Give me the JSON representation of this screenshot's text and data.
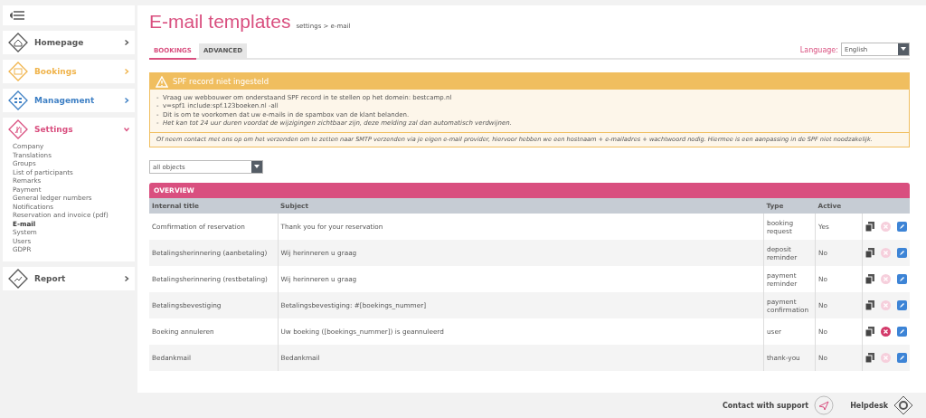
{
  "sidebar": {
    "menu_items": [
      {
        "label": "Homepage",
        "kind": "home",
        "expanded": false,
        "color": "#555555"
      },
      {
        "label": "Bookings",
        "kind": "calendar",
        "expanded": false,
        "color": "#f0b44c"
      },
      {
        "label": "Management",
        "kind": "grid",
        "expanded": false,
        "color": "#3d7fc4"
      },
      {
        "label": "Settings",
        "kind": "tools",
        "expanded": true,
        "color": "#d94f7f",
        "children": [
          {
            "label": "Company",
            "selected": false
          },
          {
            "label": "Translations",
            "selected": false
          },
          {
            "label": "Groups",
            "selected": false
          },
          {
            "label": "List of participants",
            "selected": false
          },
          {
            "label": "Remarks",
            "selected": false
          },
          {
            "label": "Payment",
            "selected": false
          },
          {
            "label": "General ledger numbers",
            "selected": false
          },
          {
            "label": "Notifications",
            "selected": false
          },
          {
            "label": "Reservation and invoice (pdf)",
            "selected": false
          },
          {
            "label": "E-mail",
            "selected": true
          },
          {
            "label": "System",
            "selected": false
          },
          {
            "label": "Users",
            "selected": false
          },
          {
            "label": "GDPR",
            "selected": false
          }
        ]
      },
      {
        "label": "Report",
        "kind": "chart",
        "expanded": false,
        "color": "#555555"
      }
    ]
  },
  "page": {
    "title": "E-mail templates",
    "breadcrumb": "settings > e-mail"
  },
  "tabs": [
    {
      "label": "BOOKINGS",
      "selected": true
    },
    {
      "label": "ADVANCED",
      "selected": false
    }
  ],
  "language": {
    "label": "Language:",
    "value": "English"
  },
  "alert": {
    "title": "SPF record niet ingesteld",
    "lines": [
      {
        "text": "-  Vraag uw webbouwer om onderstaand SPF record in te stellen op het domein: bestcamp.nl",
        "italic": false
      },
      {
        "text": "-  v=spf1 include:spf.123boeken.nl -all",
        "italic": false
      },
      {
        "text": "-  Dit is om te voorkomen dat uw e-mails in de spambox van de klant belanden.",
        "italic": false
      },
      {
        "text": "-  Het kan tot 24 uur duren voordat de wijzigingen zichtbaar zijn, deze melding zal dan automatisch verdwijnen.",
        "italic": true
      }
    ],
    "footer": "Of neem contact met ons op om het verzenden om te zetten naar SMTP verzenden via je eigen e-mail provider, hiervoor hebben we een hostnaam + e-mailadres + wachtwoord nodig. Hiermee is een aanpassing in de SPF niet noodzakelijk."
  },
  "filter": {
    "value": "all objects"
  },
  "overview": {
    "title": "OVERVIEW",
    "columns": [
      "Internal title",
      "Subject",
      "Type",
      "Active"
    ],
    "rows": [
      {
        "title": "Comfirmation of reservation",
        "subject": "Thank you for your reservation",
        "type": "booking request",
        "active": "Yes",
        "deletable": false
      },
      {
        "title": "Betalingsherinnering (aanbetaling)",
        "subject": "Wij herinneren u graag",
        "type": "deposit reminder",
        "active": "No",
        "deletable": false
      },
      {
        "title": "Betalingsherinnering (restbetaling)",
        "subject": "Wij herinneren u graag",
        "type": "payment reminder",
        "active": "No",
        "deletable": false
      },
      {
        "title": "Betalingsbevestiging",
        "subject": "Betalingsbevestiging: #[boekings_nummer]",
        "type": "payment confirmation",
        "active": "No",
        "deletable": false
      },
      {
        "title": "Boeking annuleren",
        "subject": "Uw boeking ([boekings_nummer]) is geannuleerd",
        "type": "user",
        "active": "No",
        "deletable": true
      },
      {
        "title": "Bedankmail",
        "subject": "Bedankmail",
        "type": "thank-you",
        "active": "No",
        "deletable": false
      }
    ]
  },
  "footer": {
    "support": "Contact with support",
    "helpdesk": "Helpdesk"
  }
}
